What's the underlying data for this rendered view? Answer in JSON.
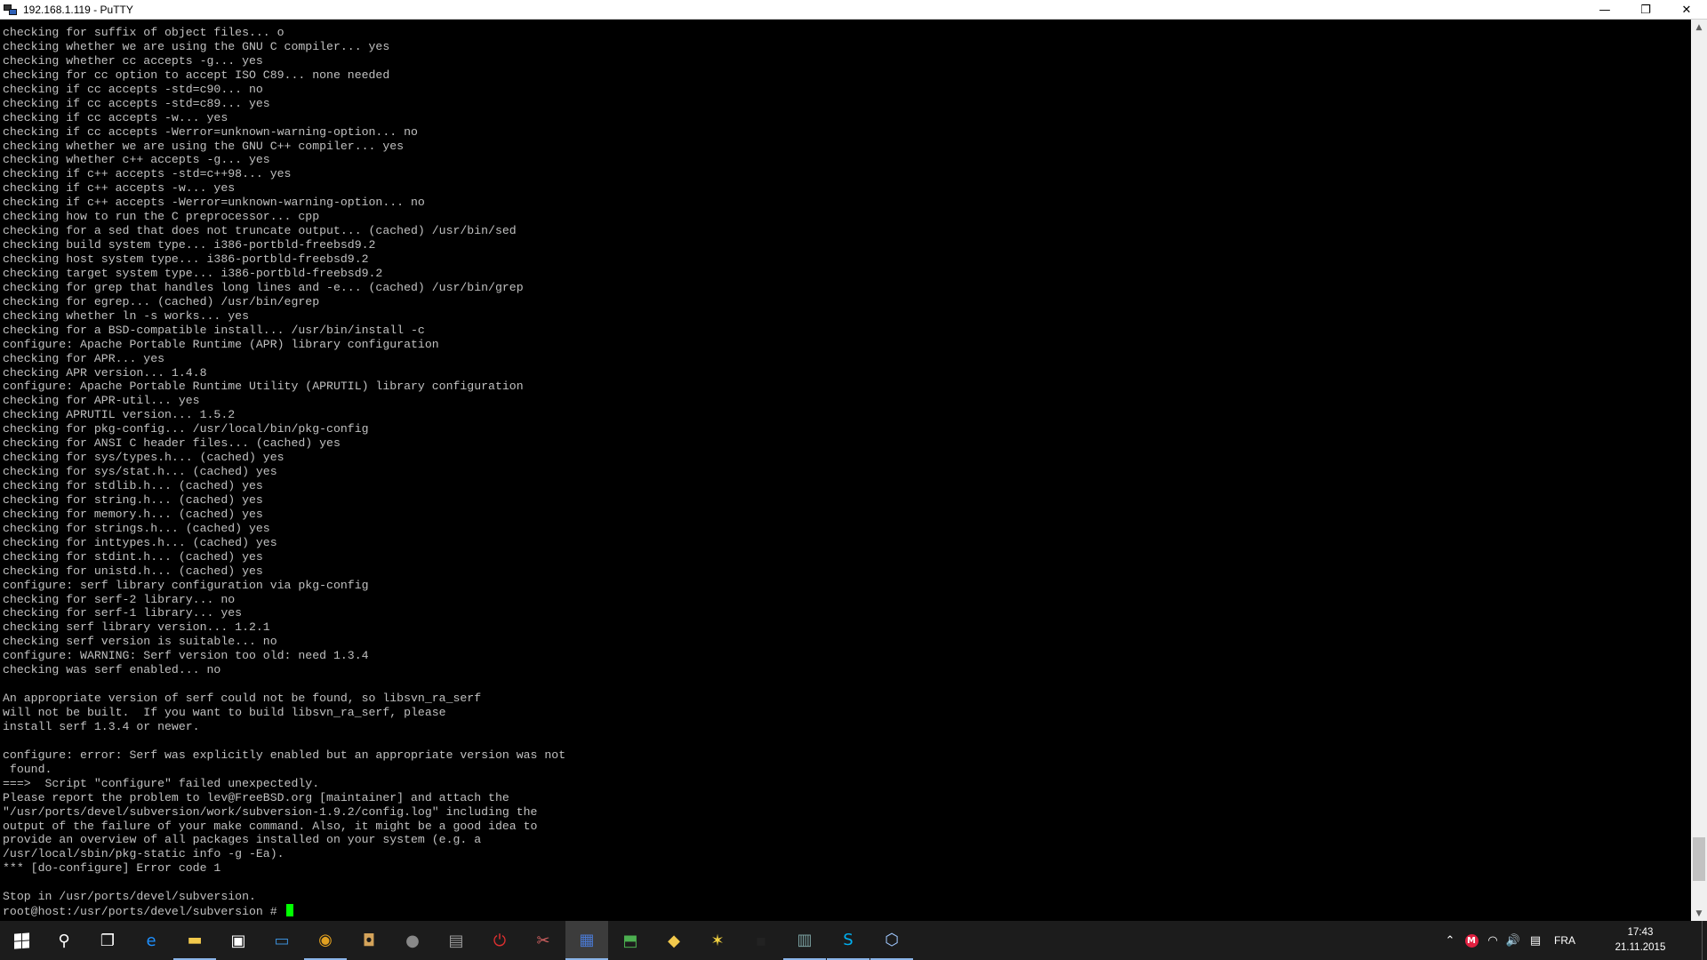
{
  "window": {
    "title": "192.168.1.119 - PuTTY",
    "minimize": "—",
    "restore": "❐",
    "close": "✕"
  },
  "terminal": {
    "lines": [
      "checking for suffix of object files... o",
      "checking whether we are using the GNU C compiler... yes",
      "checking whether cc accepts -g... yes",
      "checking for cc option to accept ISO C89... none needed",
      "checking if cc accepts -std=c90... no",
      "checking if cc accepts -std=c89... yes",
      "checking if cc accepts -w... yes",
      "checking if cc accepts -Werror=unknown-warning-option... no",
      "checking whether we are using the GNU C++ compiler... yes",
      "checking whether c++ accepts -g... yes",
      "checking if c++ accepts -std=c++98... yes",
      "checking if c++ accepts -w... yes",
      "checking if c++ accepts -Werror=unknown-warning-option... no",
      "checking how to run the C preprocessor... cpp",
      "checking for a sed that does not truncate output... (cached) /usr/bin/sed",
      "checking build system type... i386-portbld-freebsd9.2",
      "checking host system type... i386-portbld-freebsd9.2",
      "checking target system type... i386-portbld-freebsd9.2",
      "checking for grep that handles long lines and -e... (cached) /usr/bin/grep",
      "checking for egrep... (cached) /usr/bin/egrep",
      "checking whether ln -s works... yes",
      "checking for a BSD-compatible install... /usr/bin/install -c",
      "configure: Apache Portable Runtime (APR) library configuration",
      "checking for APR... yes",
      "checking APR version... 1.4.8",
      "configure: Apache Portable Runtime Utility (APRUTIL) library configuration",
      "checking for APR-util... yes",
      "checking APRUTIL version... 1.5.2",
      "checking for pkg-config... /usr/local/bin/pkg-config",
      "checking for ANSI C header files... (cached) yes",
      "checking for sys/types.h... (cached) yes",
      "checking for sys/stat.h... (cached) yes",
      "checking for stdlib.h... (cached) yes",
      "checking for string.h... (cached) yes",
      "checking for memory.h... (cached) yes",
      "checking for strings.h... (cached) yes",
      "checking for inttypes.h... (cached) yes",
      "checking for stdint.h... (cached) yes",
      "checking for unistd.h... (cached) yes",
      "configure: serf library configuration via pkg-config",
      "checking for serf-2 library... no",
      "checking for serf-1 library... yes",
      "checking serf library version... 1.2.1",
      "checking serf version is suitable... no",
      "configure: WARNING: Serf version too old: need 1.3.4",
      "checking was serf enabled... no",
      "",
      "An appropriate version of serf could not be found, so libsvn_ra_serf",
      "will not be built.  If you want to build libsvn_ra_serf, please",
      "install serf 1.3.4 or newer.",
      "",
      "configure: error: Serf was explicitly enabled but an appropriate version was not",
      " found.",
      "===>  Script \"configure\" failed unexpectedly.",
      "Please report the problem to lev@FreeBSD.org [maintainer] and attach the",
      "\"/usr/ports/devel/subversion/work/subversion-1.9.2/config.log\" including the",
      "output of the failure of your make command. Also, it might be a good idea to",
      "provide an overview of all packages installed on your system (e.g. a",
      "/usr/local/sbin/pkg-static info -g -Ea).",
      "*** [do-configure] Error code 1",
      "",
      "Stop in /usr/ports/devel/subversion."
    ],
    "prompt": "root@host:/usr/ports/devel/subversion # ",
    "scroll_position": 0.97,
    "scroll_visible_fraction": 0.05
  },
  "taskbar": {
    "items": [
      {
        "name": "search-icon",
        "glyph": "⚲",
        "color": "#ffffff"
      },
      {
        "name": "task-view-icon",
        "glyph": "❐",
        "color": "#ffffff"
      },
      {
        "name": "edge-icon",
        "glyph": "e",
        "color": "#1e90ff",
        "running": false
      },
      {
        "name": "file-explorer-icon",
        "glyph": "▬",
        "color": "#f2c94c",
        "running": true
      },
      {
        "name": "store-icon",
        "glyph": "▣",
        "color": "#ffffff"
      },
      {
        "name": "remote-desktop-icon",
        "glyph": "▭",
        "color": "#3b8fd9"
      },
      {
        "name": "chrome-icon",
        "glyph": "◉",
        "color": "#e0a020",
        "running": true
      },
      {
        "name": "app-icon-generic",
        "glyph": "◘",
        "color": "#d4a35a"
      },
      {
        "name": "audio-app-icon",
        "glyph": "●",
        "color": "#888888"
      },
      {
        "name": "disk-app-icon",
        "glyph": "▤",
        "color": "#9a9a9a"
      },
      {
        "name": "shutdown-app-icon",
        "glyph": "⏻",
        "color": "#e03030"
      },
      {
        "name": "tools-app-icon",
        "glyph": "✂",
        "color": "#d06060"
      },
      {
        "name": "putty-icon",
        "glyph": "▦",
        "color": "#4a78d0",
        "active": true
      },
      {
        "name": "network-app-icon",
        "glyph": "⬒",
        "color": "#4caf50"
      },
      {
        "name": "chicken-app-icon",
        "glyph": "◆",
        "color": "#f2c94c"
      },
      {
        "name": "star-app-icon",
        "glyph": "✶",
        "color": "#f0d040"
      },
      {
        "name": "console-app-icon",
        "glyph": "▪",
        "color": "#222222"
      },
      {
        "name": "terminal-app-icon",
        "glyph": "▥",
        "color": "#7aa0a0",
        "running": true
      },
      {
        "name": "skype-icon",
        "glyph": "S",
        "color": "#00aff0",
        "running": true
      },
      {
        "name": "virtualbox-icon",
        "glyph": "⬡",
        "color": "#a0c8ff",
        "running": true
      }
    ],
    "tray": {
      "chevron": "⌃",
      "antivirus_icon": "M",
      "wifi_icon": "◠",
      "volume_icon": "🔊",
      "message_icon": "▤",
      "language": "FRA",
      "time": "17:43",
      "date": "21.11.2015"
    }
  }
}
